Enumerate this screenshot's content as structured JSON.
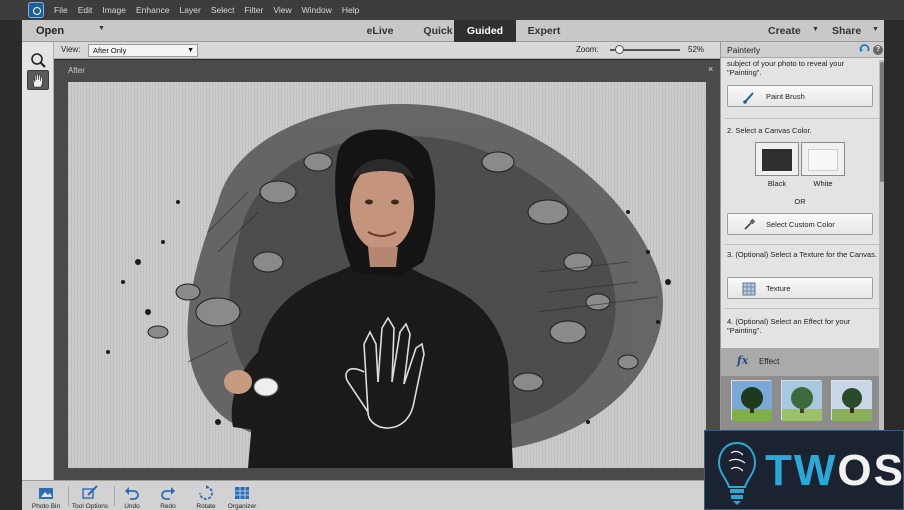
{
  "menubar": {
    "items": [
      "File",
      "Edit",
      "Image",
      "Enhance",
      "Layer",
      "Select",
      "Filter",
      "View",
      "Window",
      "Help"
    ]
  },
  "modebar": {
    "open_label": "Open",
    "tabs": [
      "eLive",
      "Quick",
      "Guided",
      "Expert"
    ],
    "active_tab": "Guided",
    "create_label": "Create",
    "share_label": "Share"
  },
  "options": {
    "view_label": "View:",
    "view_value": "After Only",
    "zoom_label": "Zoom:",
    "zoom_value": "52%",
    "zoom_level": 0.52
  },
  "canvas": {
    "title": "After",
    "close": "×"
  },
  "panel": {
    "title": "Painterly",
    "step1_text": "subject of your photo to reveal your \"Painting\".",
    "paint_brush_label": "Paint Brush",
    "step2_text": "2. Select a Canvas Color.",
    "black_label": "Black",
    "white_label": "White",
    "or_text": "OR",
    "custom_color_label": "Select Custom Color",
    "step3_text": "3. (Optional) Select a Texture for the Canvas.",
    "texture_label": "Texture",
    "step4_text": "4. (Optional) Select an Effect for your \"Painting\".",
    "effect_label": "Effect",
    "help": "?"
  },
  "bottombar": {
    "items": [
      {
        "label": "Photo Bin",
        "icon": "photo-bin-icon"
      },
      {
        "label": "Tool Options",
        "icon": "tool-options-icon"
      },
      {
        "label": "Undo",
        "icon": "undo-icon"
      },
      {
        "label": "Redo",
        "icon": "redo-icon"
      },
      {
        "label": "Rotate",
        "icon": "rotate-icon"
      },
      {
        "label": "Organizer",
        "icon": "organizer-icon"
      }
    ]
  },
  "watermark": {
    "brand": "TWOS",
    "tw": "TW",
    "os": "OS"
  },
  "colors": {
    "active_tab": "#2f2f2f",
    "canvas_bg": "#4a4a4a",
    "brand_blue": "#2aa8d8"
  }
}
